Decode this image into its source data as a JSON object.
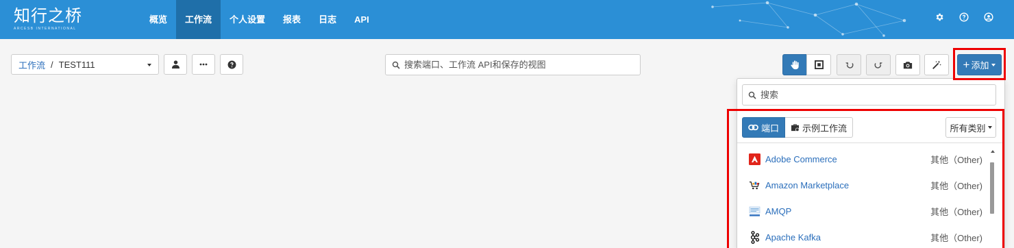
{
  "logo": {
    "cn": "知行之桥",
    "en": "ARCESB INTERNATIONAL"
  },
  "nav": {
    "items": [
      {
        "label": "概览",
        "active": false
      },
      {
        "label": "工作流",
        "active": true
      },
      {
        "label": "个人设置",
        "active": false
      },
      {
        "label": "报表",
        "active": false
      },
      {
        "label": "日志",
        "active": false
      },
      {
        "label": "API",
        "active": false
      }
    ],
    "icons": [
      "gear-icon",
      "help-icon",
      "user-icon"
    ]
  },
  "toolbar": {
    "breadcrumb_link": "工作流",
    "breadcrumb_sep": "/",
    "workflow_name": "TEST111",
    "search_placeholder": "搜索端口、工作流 API和保存的视图",
    "add_label": "添加"
  },
  "panel": {
    "search_placeholder": "搜索",
    "tab_ports": "端口",
    "tab_examples": "示例工作流",
    "category_label": "所有类别",
    "items": [
      {
        "name": "Adobe Commerce",
        "category": "其他（Other)",
        "icon": "adobe-commerce-icon"
      },
      {
        "name": "Amazon Marketplace",
        "category": "其他（Other)",
        "icon": "amazon-marketplace-icon"
      },
      {
        "name": "AMQP",
        "category": "其他（Other)",
        "icon": "amqp-icon"
      },
      {
        "name": "Apache Kafka",
        "category": "其他（Other)",
        "icon": "apache-kafka-icon"
      }
    ]
  },
  "colors": {
    "topbar": "#2b8fd6",
    "primary": "#337ab7",
    "highlight": "#e00000"
  }
}
